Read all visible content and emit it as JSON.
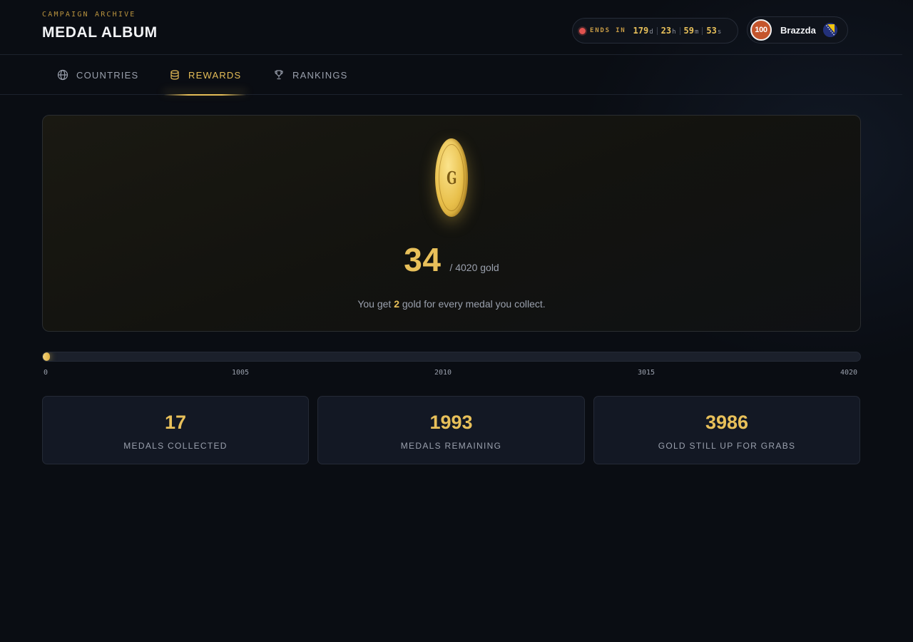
{
  "header": {
    "eyebrow": "CAMPAIGN ARCHIVE",
    "title": "MEDAL ALBUM",
    "timer": {
      "label": "ENDS IN",
      "days": "179",
      "days_unit": "d",
      "hours": "23",
      "hours_unit": "h",
      "minutes": "59",
      "minutes_unit": "m",
      "seconds": "53",
      "seconds_unit": "s"
    },
    "user": {
      "level": "100",
      "name": "Brazzda",
      "flag_icon": "bosnia-flag-icon"
    }
  },
  "tabs": [
    {
      "label": "COUNTRIES",
      "icon": "globe-icon",
      "active": false
    },
    {
      "label": "REWARDS",
      "icon": "coins-stack-icon",
      "active": true
    },
    {
      "label": "RANKINGS",
      "icon": "trophy-icon",
      "active": false
    }
  ],
  "rewards": {
    "coin_letter": "G",
    "gold_amount": "34",
    "gold_total": "/ 4020 gold",
    "earn_prefix": "You get",
    "earn_value": "2",
    "earn_suffix": "gold for every medal you collect.",
    "progress_fraction": 0.0085,
    "ticks": [
      "0",
      "1005",
      "2010",
      "3015",
      "4020"
    ]
  },
  "stats": [
    {
      "value": "17",
      "label": "MEDALS COLLECTED"
    },
    {
      "value": "1993",
      "label": "MEDALS REMAINING"
    },
    {
      "value": "3986",
      "label": "GOLD STILL UP FOR GRABS"
    }
  ],
  "colors": {
    "accent_gold": "#e8c05a",
    "background": "#0a0d13",
    "live_dot": "#e0524f",
    "avatar": "#c4552c"
  }
}
